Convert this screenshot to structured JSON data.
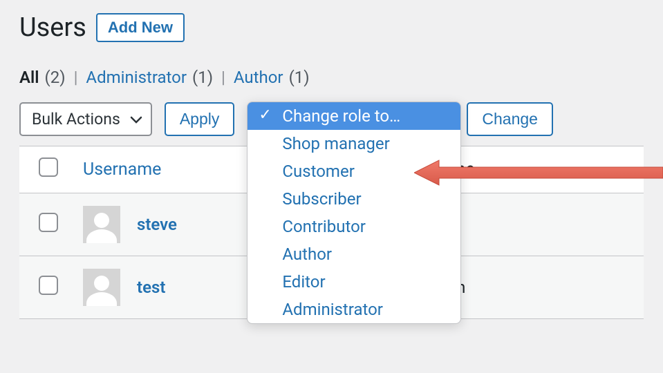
{
  "header": {
    "page_title": "Users",
    "add_new_label": "Add New"
  },
  "filters": {
    "all_label": "All",
    "all_count": "(2)",
    "items": [
      {
        "label": "Administrator",
        "count": "(1)"
      },
      {
        "label": "Author",
        "count": "(1)"
      }
    ]
  },
  "actions": {
    "bulk_label": "Bulk Actions",
    "apply_label": "Apply",
    "change_label": "Change"
  },
  "role_dropdown": {
    "selected": "Change role to…",
    "options": [
      "Change role to…",
      "Shop manager",
      "Customer",
      "Subscriber",
      "Contributor",
      "Author",
      "Editor",
      "Administrator"
    ]
  },
  "table": {
    "columns": {
      "username": "Username",
      "name": "Name"
    },
    "rows": [
      {
        "username": "steve",
        "name": "—"
      },
      {
        "username": "test",
        "name": "John"
      }
    ]
  }
}
